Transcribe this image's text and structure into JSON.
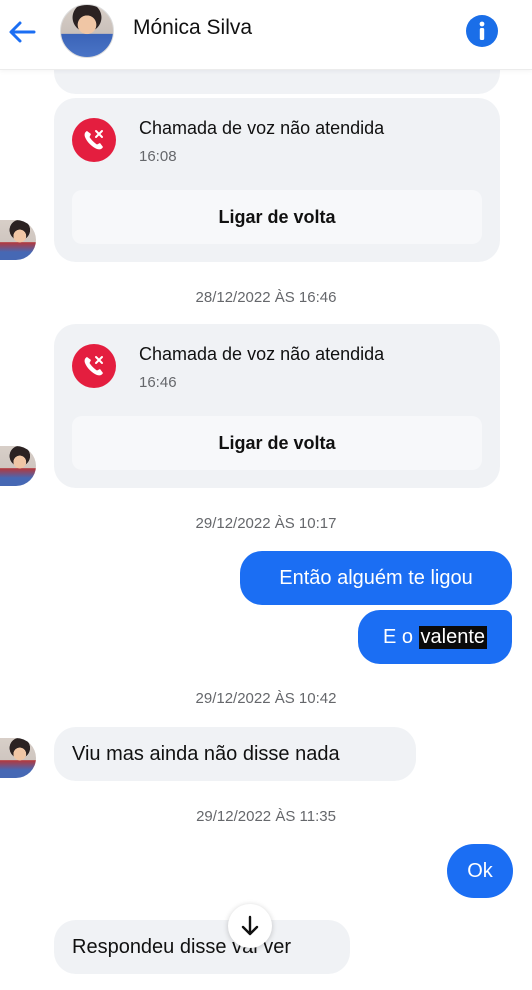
{
  "header": {
    "contact_name": "Mónica Silva",
    "back_icon": "arrow-left-icon",
    "info_icon": "info-icon"
  },
  "colors": {
    "accent": "#1b6ef3",
    "missed_call": "#e41e3f",
    "incoming_bubble": "#f0f2f5"
  },
  "messages": {
    "call1": {
      "title": "Chamada de voz não atendida",
      "time": "16:08",
      "action": "Ligar de volta"
    },
    "ts1": "28/12/2022 ÀS 16:46",
    "call2": {
      "title": "Chamada de voz não atendida",
      "time": "16:46",
      "action": "Ligar de volta"
    },
    "ts2": "29/12/2022 ÀS 10:17",
    "out1": "Então alguém te ligou",
    "out2_prefix": "E o",
    "out2_highlight": "valente",
    "ts3": "29/12/2022 ÀS 10:42",
    "in1": "Viu mas ainda não disse nada",
    "ts4": "29/12/2022 ÀS 11:35",
    "out3": "Ok",
    "in2": "Respondeu disse vai ver"
  }
}
